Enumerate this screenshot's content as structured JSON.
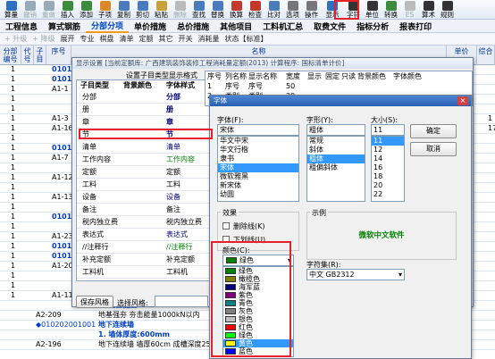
{
  "toolbar": {
    "items": [
      {
        "label": "算量",
        "icon": "calculator-icon",
        "color": "#2f6fbf",
        "enabled": true
      },
      {
        "label": "撤销",
        "icon": "undo-icon",
        "color": "#9ab",
        "enabled": false
      },
      {
        "label": "重做",
        "icon": "redo-icon",
        "color": "#9ab",
        "enabled": false
      },
      {
        "label": "插入",
        "icon": "insert-icon",
        "color": "#3d8c3d",
        "enabled": true
      },
      {
        "label": "添加",
        "icon": "add-icon",
        "color": "#3d8c3d",
        "enabled": true
      },
      {
        "label": "子项",
        "icon": "subitem-icon",
        "color": "#d9892b",
        "enabled": true
      },
      {
        "label": "复制",
        "icon": "copy-icon",
        "color": "#4b7bbf",
        "enabled": true
      },
      {
        "label": "剪切",
        "icon": "cut-icon",
        "color": "#4b7bbf",
        "enabled": true
      },
      {
        "label": "粘贴",
        "icon": "paste-icon",
        "color": "#c9a13b",
        "enabled": true
      },
      {
        "label": "删除",
        "icon": "delete-icon",
        "color": "#bbb",
        "enabled": false
      },
      {
        "label": "查找",
        "icon": "find-icon",
        "color": "#4b7bbf",
        "enabled": true
      },
      {
        "label": "替换",
        "icon": "replace-icon",
        "color": "#4b7bbf",
        "enabled": true
      },
      {
        "label": "换算",
        "icon": "convert-icon",
        "color": "#c0392b",
        "enabled": true
      },
      {
        "label": "检查",
        "icon": "check-icon",
        "color": "#c0392b",
        "enabled": true
      },
      {
        "label": "比对",
        "icon": "compare-icon",
        "color": "#4b7bbf",
        "enabled": true
      },
      {
        "label": "选项",
        "icon": "options-icon",
        "color": "#777",
        "enabled": true
      },
      {
        "label": "操作",
        "icon": "operation-icon",
        "color": "#777",
        "enabled": true
      },
      {
        "label": "显示",
        "icon": "display-icon",
        "color": "#2f6fbf",
        "enabled": true
      },
      {
        "label": "字符",
        "icon": "font-icon",
        "color": "#333",
        "enabled": true
      },
      {
        "label": "单位",
        "icon": "unit-icon",
        "color": "#333",
        "enabled": true
      },
      {
        "label": "转换",
        "icon": "transform-icon",
        "color": "#3d8c3d",
        "enabled": true
      },
      {
        "label": "ES",
        "icon": "es-icon",
        "color": "#bbb",
        "enabled": false
      },
      {
        "label": "算术",
        "icon": "arithmetic-icon",
        "color": "#333",
        "enabled": true
      },
      {
        "label": "规则",
        "icon": "rules-icon",
        "color": "#333",
        "enabled": true
      }
    ]
  },
  "menu": {
    "items": [
      "工程信息",
      "算式钢筋",
      "分部分项",
      "单价措施",
      "总价措施",
      "其他项目",
      "工料机汇总",
      "取费文件",
      "指标分析",
      "报表打印"
    ],
    "active": 2
  },
  "subbar": {
    "items": [
      "+ 升级",
      "+ 降级",
      "展开",
      "专业",
      "棋盘",
      "清单",
      "定额",
      "其它",
      "开关",
      "消耗量",
      "状态【标准】"
    ]
  },
  "grid": {
    "headers": [
      "分部\n编号",
      "代\n号",
      "子\n目",
      "序号",
      "名称",
      "单价",
      "综合"
    ],
    "rows": [
      {
        "c1": "1",
        "c2": "",
        "c3": "0101",
        "c4": "",
        "c5": "",
        "blue": true
      },
      {
        "c1": "1",
        "c2": "",
        "c3": "0101",
        "c4": "",
        "c5": "",
        "blue": true
      },
      {
        "c1": "1",
        "c2": "",
        "c3": "A1-1",
        "c4": "",
        "c5": ""
      },
      {
        "c1": "1",
        "c2": "",
        "c3": "",
        "c4": "",
        "c5": ""
      },
      {
        "c1": "1",
        "c2": "",
        "c3": "",
        "c4": "",
        "c5": ""
      },
      {
        "c1": "1",
        "c2": "",
        "c3": "A1-3",
        "c4": "",
        "c5": "1"
      },
      {
        "c1": "1",
        "c2": "",
        "c3": "A1-16",
        "c4": "",
        "c5": "17"
      },
      {
        "c1": "1",
        "c2": "",
        "c3": "",
        "c4": "",
        "c5": ""
      },
      {
        "c1": "1",
        "c2": "",
        "c3": "0101",
        "c4": "",
        "c5": "",
        "blue": true
      },
      {
        "c1": "1",
        "c2": "",
        "c3": "A1-7",
        "c4": "",
        "c5": ""
      },
      {
        "c1": "1",
        "c2": "",
        "c3": "",
        "c4": "",
        "c5": ""
      },
      {
        "c1": "1",
        "c2": "",
        "c3": "A1-12",
        "c4": "",
        "c5": ""
      },
      {
        "c1": "1",
        "c2": "",
        "c3": "",
        "c4": "",
        "c5": ""
      },
      {
        "c1": "1",
        "c2": "",
        "c3": "A1-13",
        "c4": "",
        "c5": ""
      },
      {
        "c1": "1",
        "c2": "",
        "c3": "",
        "c4": "",
        "c5": ""
      },
      {
        "c1": "1",
        "c2": "",
        "c3": "0101",
        "c4": "",
        "c5": "",
        "blue": true
      },
      {
        "c1": "1",
        "c2": "",
        "c3": "",
        "c4": "",
        "c5": ""
      },
      {
        "c1": "1",
        "c2": "",
        "c3": "A1-23",
        "c4": "",
        "c5": ""
      },
      {
        "c1": "1",
        "c2": "",
        "c3": "0101",
        "c4": "",
        "c5": "",
        "blue": true
      },
      {
        "c1": "1",
        "c2": "",
        "c3": "0101",
        "c4": "",
        "c5": "",
        "blue": true
      },
      {
        "c1": "1",
        "c2": "",
        "c3": "A1-20",
        "c4": "",
        "c5": ""
      },
      {
        "c1": "1",
        "c2": "",
        "c3": "",
        "c4": "",
        "c5": ""
      },
      {
        "c1": "1",
        "c2": "",
        "c3": "",
        "c4": "",
        "c5": ""
      },
      {
        "c1": "1",
        "c2": "",
        "c3": "A1-11",
        "c4": "",
        "c5": ""
      }
    ],
    "bottom_rows": [
      {
        "c3": "",
        "name": "1. 充土能量:1000kN·m",
        "blue": true
      },
      {
        "c3": "A2-209",
        "name": "地基强夯 夯击能量1000kN以内",
        "unit": "10m²",
        "qty": "1.0000"
      },
      {
        "c3": "◆010202001001",
        "name": "地下连续墙",
        "unit": "m³",
        "qty": "1",
        "blue": true
      },
      {
        "c3": "",
        "name": "1. 墙体厚度:600mm",
        "blue": true
      },
      {
        "c3": "A2-196",
        "name": "地下连续墙 墙厚60cm 成槽深度25m以内 商品水下砼 C25]",
        "unit": "10m³",
        "qty": "0.1000"
      },
      {
        "c3": "",
        "name": "",
        "qty": "1"
      }
    ]
  },
  "settings_dialog": {
    "title": "显示设置  [当前定额库: 广西建筑装饰装修工程消耗量定额(2013) 计算程序: 国标清单计价]",
    "subtitle": "设置子目类型显示格式",
    "col_headers": [
      "子目类型",
      "背景颜色",
      "字体样式"
    ],
    "rows": [
      {
        "type": "分部",
        "style": "分部",
        "color": "#000080",
        "bold": true
      },
      {
        "type": "册",
        "style": "册",
        "color": "#000080",
        "bold": true
      },
      {
        "type": "章",
        "style": "章",
        "color": "#000080",
        "bold": true
      },
      {
        "type": "节",
        "style": "节",
        "color": "#000080",
        "bold": true
      },
      {
        "type": "清单",
        "style": "清单",
        "color": "#000080",
        "selected": true
      },
      {
        "type": "工作内容",
        "style": "工作内容",
        "color": "#008000"
      },
      {
        "type": "定额",
        "style": "定额",
        "color": "#000000"
      },
      {
        "type": "工料",
        "style": "工料",
        "color": "#000000"
      },
      {
        "type": "设备",
        "style": "设备",
        "color": "#000080"
      },
      {
        "type": "备注",
        "style": "备注",
        "color": "#000000"
      },
      {
        "type": "税内独立费",
        "style": "税内独立费",
        "color": "#000000"
      },
      {
        "type": "表达式",
        "style": "表达式",
        "color": "#000080"
      },
      {
        "type": "//注释行",
        "style": "//注释行",
        "color": "#008000"
      },
      {
        "type": "补充定额",
        "style": "补充定额",
        "color": "#000000"
      },
      {
        "type": "工料机",
        "style": "工料机",
        "color": "#000000"
      }
    ],
    "right_headers": [
      "序号",
      "列名称",
      "显示名称",
      "宽度",
      "显示",
      "固定",
      "只读",
      "背景颜色",
      "字体颜色"
    ],
    "right_rows": [
      {
        "seq": "1",
        "name": "序号",
        "disp": "序号",
        "width": "50"
      },
      {
        "seq": "2",
        "name": "类别",
        "disp": "类别",
        "width": "29"
      }
    ],
    "save_label": "保存风格",
    "select_label": "选择风格:"
  },
  "font_dialog": {
    "title": "字体",
    "font_label": "字体(F):",
    "font_value": "宋体",
    "fonts": [
      "华文中宋",
      "华文行楷",
      "隶书",
      "宋体",
      "微软雅黑",
      "新宋体",
      "幼圆"
    ],
    "font_selected": 3,
    "style_label": "字形(Y):",
    "style_value": "粗体",
    "styles": [
      "常规",
      "斜体",
      "粗体",
      "粗偏斜体"
    ],
    "style_selected": 2,
    "size_label": "大小(S):",
    "size_value": "11",
    "sizes": [
      "11",
      "12",
      "14",
      "16",
      "18",
      "20",
      "22"
    ],
    "size_selected": 0,
    "ok_label": "确定",
    "cancel_label": "取消",
    "effects_label": "效果",
    "strike_label": "删除线(K)",
    "underline_label": "下划线(U)",
    "color_label": "颜色(C):",
    "color_value": "绿色",
    "color_hex": "#008000",
    "sample_label": "示例",
    "sample_text": "微软中文软件",
    "script_label": "字符集(R):",
    "script_value": "中文 GB2312",
    "colors": [
      {
        "name": "绿色",
        "hex": "#008000"
      },
      {
        "name": "橄榄色",
        "hex": "#808000"
      },
      {
        "name": "海军蓝",
        "hex": "#000080"
      },
      {
        "name": "紫色",
        "hex": "#800080"
      },
      {
        "name": "青色",
        "hex": "#008080"
      },
      {
        "name": "灰色",
        "hex": "#808080"
      },
      {
        "name": "银色",
        "hex": "#c0c0c0"
      },
      {
        "name": "红色",
        "hex": "#ff0000"
      },
      {
        "name": "绿色",
        "hex": "#00ff00"
      },
      {
        "name": "黄色",
        "hex": "#ffff00"
      },
      {
        "name": "蓝色",
        "hex": "#0000ff"
      }
    ],
    "color_selected": 9
  }
}
